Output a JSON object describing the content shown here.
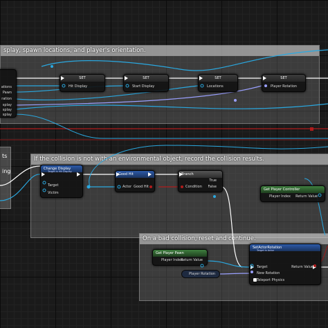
{
  "comments": {
    "top": "splay, spawn locations, and player's orientation.",
    "middle": "If the collision is not with an environmental object, record the collision results.",
    "bottom": "On a bad collision, reset and continue.",
    "left_fragment_1": "ts",
    "left_fragment_2": "ing"
  },
  "left_node": {
    "pins": [
      "ations",
      "Pawn",
      "ration",
      "splay",
      "splay",
      "splay"
    ]
  },
  "set_nodes": [
    {
      "title": "SET",
      "pin": "Hit Display"
    },
    {
      "title": "SET",
      "pin": "Start Display"
    },
    {
      "title": "SET",
      "pin": "Locations"
    },
    {
      "title": "SET",
      "pin": "Player Rotation"
    }
  ],
  "change_display": {
    "title": "Change Display",
    "subtitle": "Target is Hit Display",
    "pins": [
      "Target",
      "Victim"
    ]
  },
  "good_hit": {
    "title": "Good Hit",
    "pins": [
      "Actor"
    ],
    "out": "Good Hit"
  },
  "branch": {
    "title": "Branch",
    "pin": "Condition",
    "true_label": "True",
    "false_label": "False"
  },
  "get_player_controller": {
    "title": "Get Player Controller",
    "pin": "Player Index",
    "out": "Return Value"
  },
  "get_player_pawn": {
    "title": "Get Player Pawn",
    "pin": "Player Index",
    "out": "Return Value"
  },
  "player_rotation_var": "Player Rotation",
  "set_actor_rotation": {
    "title": "SetActorRotation",
    "subtitle": "Target is Actor",
    "pins": [
      "Target",
      "New Rotation",
      "Teleport Physics"
    ],
    "out": "Return Value"
  },
  "colors": {
    "exec": "#ffffff",
    "object": "#2aa8e0",
    "struct": "#9aa0ff",
    "bool": "#a01818",
    "red_wire": "#c02020"
  }
}
